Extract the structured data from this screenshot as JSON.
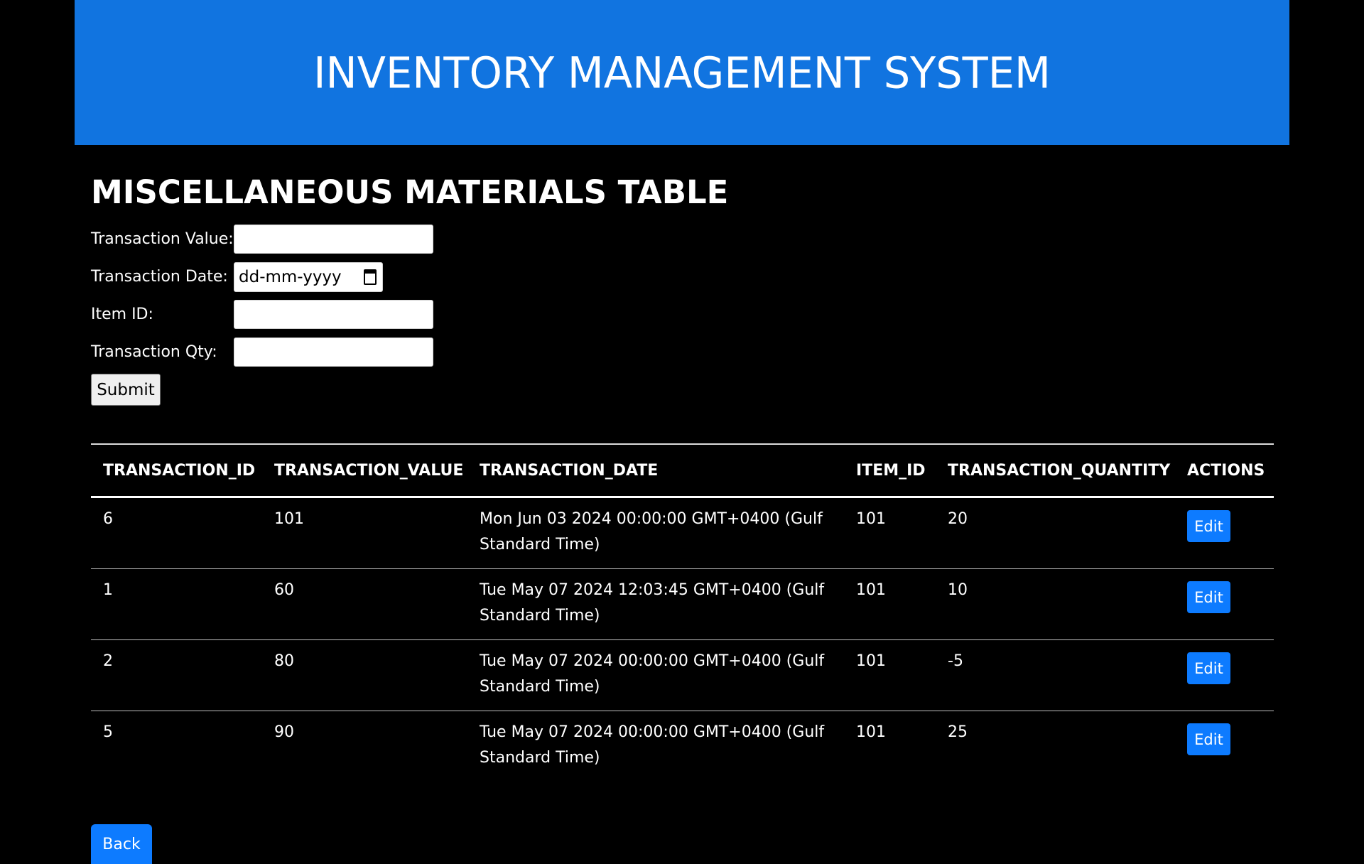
{
  "header": {
    "title": "INVENTORY MANAGEMENT SYSTEM",
    "background_color": "#1174e0"
  },
  "section": {
    "title": "MISCELLANEOUS MATERIALS TABLE"
  },
  "form": {
    "transaction_value_label": "Transaction Value:",
    "transaction_value": "",
    "transaction_date_label": "Transaction Date:",
    "transaction_date_placeholder": "dd-mm-yyyy",
    "calendar_icon": "calendar-icon",
    "item_id_label": "Item ID:",
    "item_id": "",
    "transaction_qty_label": "Transaction Qty:",
    "transaction_qty": "",
    "submit_label": "Submit"
  },
  "table": {
    "columns": [
      "TRANSACTION_ID",
      "TRANSACTION_VALUE",
      "TRANSACTION_DATE",
      "ITEM_ID",
      "TRANSACTION_QUANTITY",
      "ACTIONS"
    ],
    "rows": [
      {
        "id": "6",
        "value": "101",
        "date": "Mon Jun 03 2024 00:00:00 GMT+0400 (Gulf Standard Time)",
        "item_id": "101",
        "quantity": "20",
        "action": "Edit"
      },
      {
        "id": "1",
        "value": "60",
        "date": "Tue May 07 2024 12:03:45 GMT+0400 (Gulf Standard Time)",
        "item_id": "101",
        "quantity": "10",
        "action": "Edit"
      },
      {
        "id": "2",
        "value": "80",
        "date": "Tue May 07 2024 00:00:00 GMT+0400 (Gulf Standard Time)",
        "item_id": "101",
        "quantity": "-5",
        "action": "Edit"
      },
      {
        "id": "5",
        "value": "90",
        "date": "Tue May 07 2024 00:00:00 GMT+0400 (Gulf Standard Time)",
        "item_id": "101",
        "quantity": "25",
        "action": "Edit"
      }
    ]
  },
  "back_label": "Back",
  "colors": {
    "button_blue": "#0d7bff",
    "background": "#000000"
  }
}
